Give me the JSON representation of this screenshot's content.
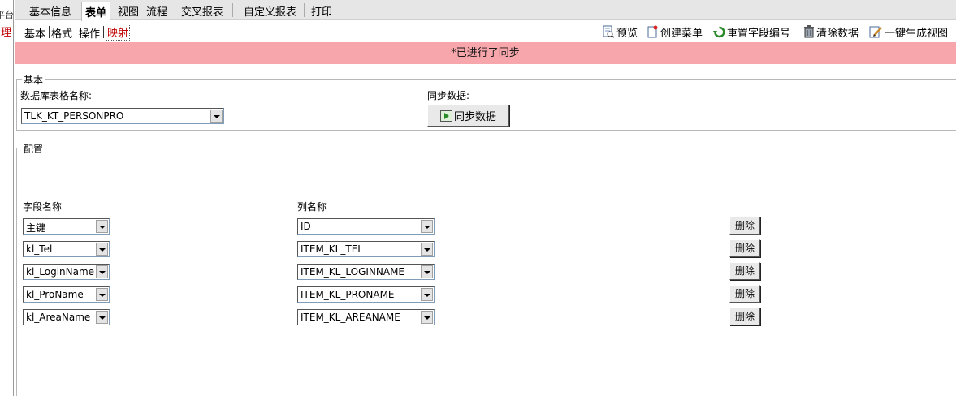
{
  "left_edge": {
    "text1": "平台",
    "text2": "理"
  },
  "tabs": [
    "基本信息",
    "表单",
    "视图",
    "流程",
    "交叉报表",
    "自定义报表",
    "打印"
  ],
  "subtabs": [
    "基本",
    "格式",
    "操作",
    "映射"
  ],
  "actions": {
    "preview": "预览",
    "create_menu": "创建菜单",
    "reset_field": "重置字段编号",
    "clear_data": "清除数据",
    "gen_view": "一键生成视图"
  },
  "status": "*已进行了同步",
  "basic": {
    "legend": "基本",
    "table_label": "数据库表格名称:",
    "table_value": "TLK_KT_PERSONPRO",
    "sync_label": "同步数据:",
    "sync_button": "同步数据"
  },
  "config": {
    "legend": "配置",
    "field_header": "字段名称",
    "column_header": "列名称",
    "delete_label": "删除",
    "rows": [
      {
        "field": "主键",
        "column": "ID"
      },
      {
        "field": "kl_Tel",
        "column": "ITEM_KL_TEL"
      },
      {
        "field": "kl_LoginName",
        "column": "ITEM_KL_LOGINNAME"
      },
      {
        "field": "kl_ProName",
        "column": "ITEM_KL_PRONAME"
      },
      {
        "field": "kl_AreaName",
        "column": "ITEM_KL_AREANAME"
      }
    ]
  },
  "colors": {
    "banner": "#f7a6ab",
    "active_subtab": "#c00000"
  },
  "icons": [
    "preview-icon",
    "create-menu-icon",
    "reset-icon",
    "trash-icon",
    "edit-view-icon",
    "sync-icon"
  ]
}
